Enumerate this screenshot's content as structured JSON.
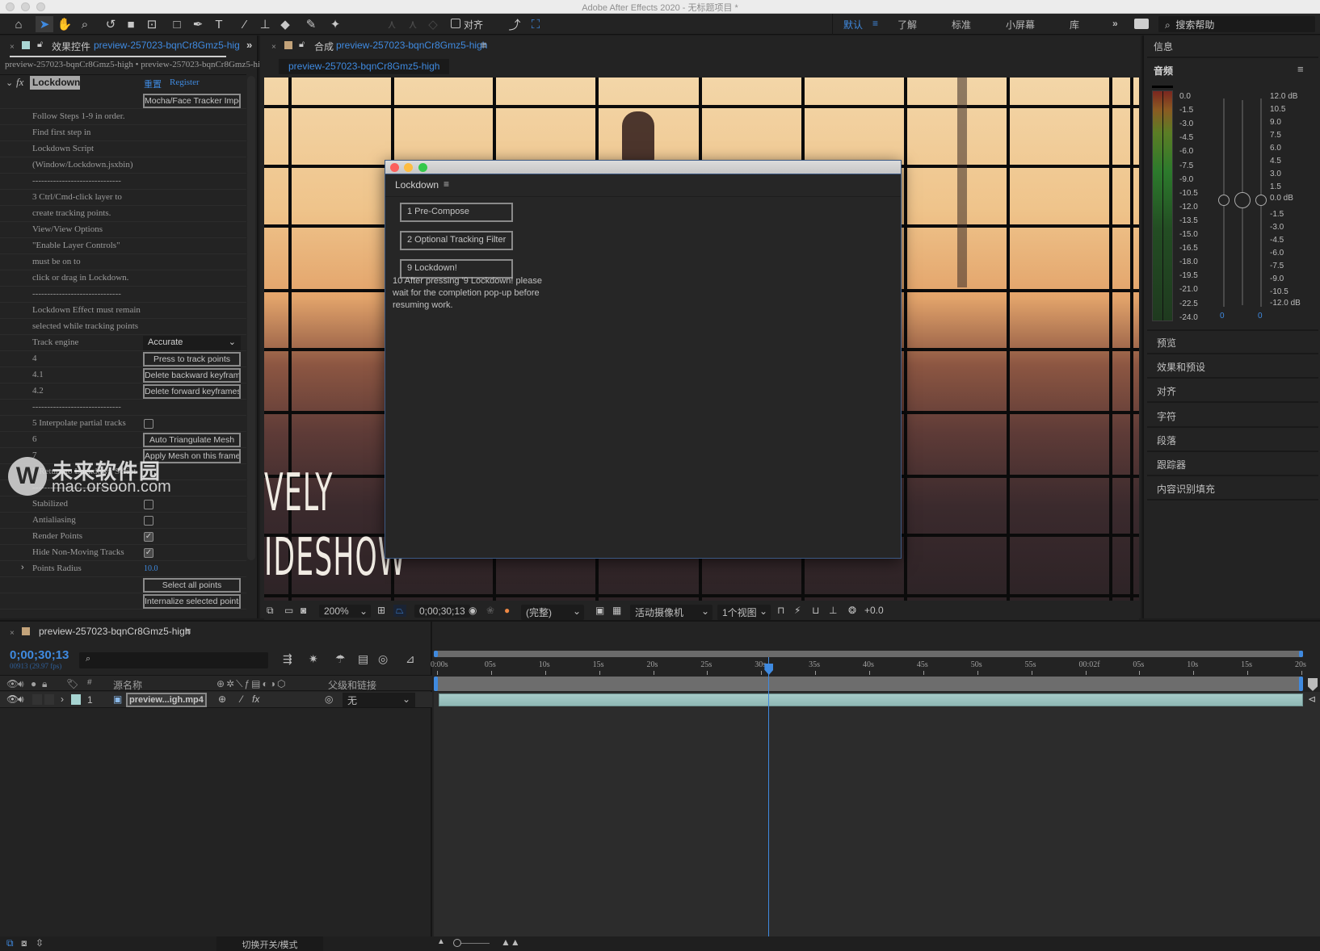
{
  "window": {
    "title": "Adobe After Effects 2020 - 无标题项目 *"
  },
  "toolbar": {
    "tools": [
      "home-icon",
      "selection-tool-icon",
      "hand-tool-icon",
      "zoom-tool-icon",
      "rotate-tool-icon",
      "camera-tool-icon",
      "pan-behind-tool-icon",
      "rectangle-tool-icon",
      "pen-tool-icon",
      "type-tool-icon",
      "brush-tool-icon",
      "clone-stamp-tool-icon",
      "eraser-tool-icon",
      "roto-brush-tool-icon",
      "puppet-pin-tool-icon"
    ],
    "snap_label": "对齐",
    "workspaces": [
      {
        "label": "默认",
        "active": true
      },
      {
        "label": "了解",
        "active": false
      },
      {
        "label": "标准",
        "active": false
      },
      {
        "label": "小屏幕",
        "active": false
      },
      {
        "label": "库",
        "active": false
      }
    ],
    "more_label": "»",
    "search_placeholder": "搜索帮助"
  },
  "effect_controls": {
    "tab_title": "效果控件",
    "tab_comp": "preview-257023-bqnCr8Gmz5-hig",
    "breadcrumb": "preview-257023-bqnCr8Gmz5-high • preview-257023-bqnCr8Gmz5-hig",
    "effect_name": "Lockdown",
    "reset_label": "重置",
    "register_label": "Register",
    "rows": [
      {
        "label": "",
        "button": "Mocha/Face Tracker Import"
      },
      {
        "label": "Follow Steps 1-9 in order."
      },
      {
        "label": "Find first step in"
      },
      {
        "label": "Lockdown Script"
      },
      {
        "label": "(Window/Lockdown.jsxbin)"
      },
      {
        "label": "------------------------------"
      },
      {
        "label": "3 Ctrl/Cmd-click layer to"
      },
      {
        "label": "create tracking points."
      },
      {
        "label": "View/View Options"
      },
      {
        "label": "\"Enable Layer Controls\""
      },
      {
        "label": "must be on to"
      },
      {
        "label": "click or drag in Lockdown."
      },
      {
        "label": "------------------------------"
      },
      {
        "label": "Lockdown Effect must remain"
      },
      {
        "label": "selected while tracking points"
      },
      {
        "label": "Track engine",
        "select": "Accurate"
      },
      {
        "label": "4",
        "button": "Press to track points"
      },
      {
        "label": "4.1",
        "button": "Delete backward keyframes"
      },
      {
        "label": "4.2",
        "button": "Delete forward keyframes"
      },
      {
        "label": "------------------------------"
      },
      {
        "label": "5 Interpolate partial tracks",
        "checkbox": false
      },
      {
        "label": "6",
        "button": "Auto Triangulate Mesh"
      },
      {
        "label": "7",
        "button": "Apply Mesh on this frame"
      },
      {
        "label": "8 Return to Lockdown Script"
      },
      {
        "label": "------------------------------"
      },
      {
        "label": "Stabilized",
        "checkbox": false
      },
      {
        "label": "Antialiasing",
        "checkbox": false
      },
      {
        "label": "Render Points",
        "checkbox": true
      },
      {
        "label": "Hide Non-Moving Tracks",
        "checkbox": true
      },
      {
        "label": "Points Radius",
        "value": "10.0",
        "expandable": true
      },
      {
        "label": "",
        "button": "Select all points"
      },
      {
        "label": "",
        "button": "Internalize selected points"
      }
    ],
    "watermark": {
      "cn": "未来软件园",
      "url": "mac.orsoon.com"
    }
  },
  "composition": {
    "tab_title": "合成",
    "tab_comp": "preview-257023-bqnCr8Gmz5-high",
    "sub_tab": "preview-257023-bqnCr8Gmz5-high",
    "overlay_text_1": "VELY",
    "overlay_text_2": "IDESHOW",
    "toolbar": {
      "zoom": "200%",
      "timecode": "0;00;30;13",
      "resolution": "(完整)",
      "camera": "活动摄像机",
      "views": "1个视图",
      "exposure": "+0.0"
    }
  },
  "lockdown_window": {
    "title": "Lockdown",
    "buttons": [
      "1 Pre-Compose",
      "2 Optional Tracking Filter",
      "9 Lockdown!"
    ],
    "note": "10 After pressing '9 Lockdown! please wait for the completion pop-up before resuming work."
  },
  "right_panel": {
    "info_label": "信息",
    "audio_label": "音频",
    "meter_scale": [
      "0.0",
      "-1.5",
      "-3.0",
      "-4.5",
      "-6.0",
      "-7.5",
      "-9.0",
      "-10.5",
      "-12.0",
      "-13.5",
      "-15.0",
      "-16.5",
      "-18.0",
      "-19.5",
      "-21.0",
      "-22.5",
      "-24.0"
    ],
    "db_scale": [
      "12.0 dB",
      "10.5",
      "9.0",
      "7.5",
      "6.0",
      "4.5",
      "3.0",
      "1.5",
      "0.0 dB",
      "-1.5",
      "-3.0",
      "-4.5",
      "-6.0",
      "-7.5",
      "-9.0",
      "-10.5",
      "-12.0 dB"
    ],
    "left_value": "0",
    "right_value": "0",
    "sections": [
      "预览",
      "效果和预设",
      "对齐",
      "字符",
      "段落",
      "跟踪器",
      "内容识别填充"
    ]
  },
  "timeline": {
    "tab_title": "preview-257023-bqnCr8Gmz5-high",
    "timecode": "0;00;30;13",
    "frame_info": "00913 (29.97 fps)",
    "search_placeholder": "",
    "columns": {
      "source_name": "源名称",
      "parent": "父级和链接",
      "number": "#"
    },
    "layers": [
      {
        "index": "1",
        "name": "preview...igh.mp4",
        "parent": "无"
      }
    ],
    "ruler": [
      "0:00s",
      "05s",
      "10s",
      "15s",
      "20s",
      "25s",
      "30s",
      "35s",
      "40s",
      "45s",
      "50s",
      "55s",
      "00:02f",
      "05s",
      "10s",
      "15s",
      "20s"
    ],
    "playhead_fraction": 0.3835,
    "toggle_label": "切换开关/模式"
  }
}
